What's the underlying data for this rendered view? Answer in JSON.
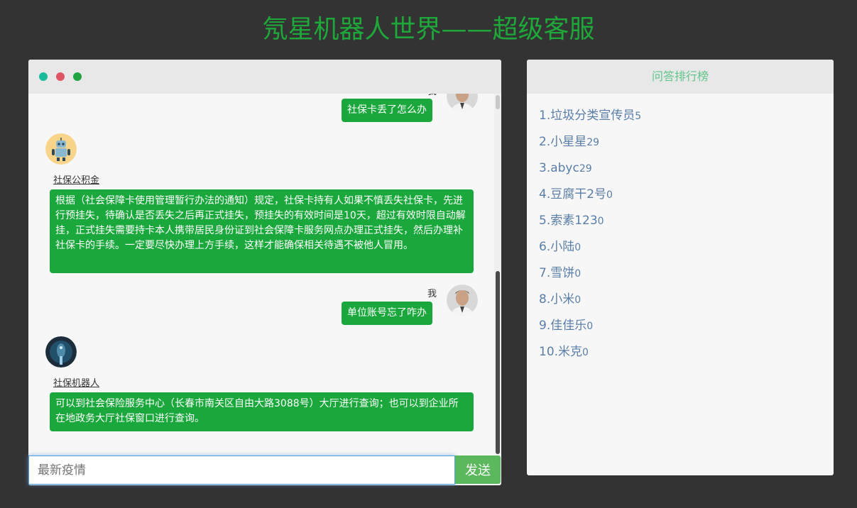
{
  "page": {
    "title": "氖星机器人世界——超级客服"
  },
  "chat": {
    "messages": [
      {
        "sender": "我",
        "text": "社保卡丢了怎么办"
      },
      {
        "sender": "社保公积金",
        "text": "根据（社会保障卡使用管理暂行办法的通知）规定，社保卡持有人如果不慎丢失社保卡，先进行预挂失，待确认是否丢失之后再正式挂失，预挂失的有效时间是10天，超过有效时限自动解挂，正式挂失需要持卡本人携带居民身份证到社会保障卡服务网点办理正式挂失，然后办理补社保卡的手续。一定要尽快办理上方手续，这样才能确保相关待遇不被他人冒用。"
      },
      {
        "sender": "我",
        "text": "单位账号忘了咋办"
      },
      {
        "sender": "社保机器人",
        "text": "可以到社会保险服务中心（长春市南关区自由大路3088号）大厅进行查询；也可以到企业所在地政务大厅社保窗口进行查询。"
      }
    ],
    "input": {
      "placeholder": "最新疫情",
      "value": ""
    },
    "send_label": "发送"
  },
  "ranking": {
    "title": "问答排行榜",
    "items": [
      {
        "name": "1.垃圾分类宣传员",
        "count": "5"
      },
      {
        "name": "2.小星星",
        "count": "29"
      },
      {
        "name": "3.abyc",
        "count": "29"
      },
      {
        "name": "4.豆腐干2号",
        "count": "0"
      },
      {
        "name": "5.索素123",
        "count": "0"
      },
      {
        "name": "6.小陆",
        "count": "0"
      },
      {
        "name": "7.雪饼",
        "count": "0"
      },
      {
        "name": "8.小米",
        "count": "0"
      },
      {
        "name": "9.佳佳乐",
        "count": "0"
      },
      {
        "name": "10.米克",
        "count": "0"
      }
    ]
  },
  "colors": {
    "accent": "#1aa83c",
    "title": "#1ea83a",
    "background": "#333333",
    "send": "#5cb85c"
  }
}
